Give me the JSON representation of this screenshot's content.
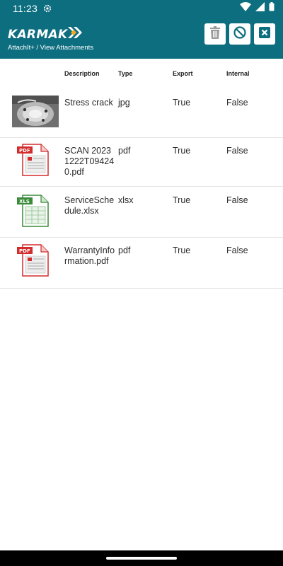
{
  "status_bar": {
    "time": "11:23"
  },
  "header": {
    "brand": "KARMAK",
    "subtitle": "AttachIt+ / View Attachments"
  },
  "toolbar": {
    "delete_icon": "trash-icon",
    "cancel_icon": "block-icon",
    "close_icon": "close-box-icon"
  },
  "table": {
    "headers": {
      "description": "Description",
      "type": "Type",
      "export": "Export",
      "internal": "Internal"
    },
    "rows": [
      {
        "thumbnail": "photo-thumbnail",
        "description": "Stress crack",
        "type": "jpg",
        "export": "True",
        "internal": "False"
      },
      {
        "thumbnail": "pdf-file-icon",
        "description": "SCAN 20231222T094240.pdf",
        "type": "pdf",
        "export": "True",
        "internal": "False"
      },
      {
        "thumbnail": "xls-file-icon",
        "description": "ServiceSchedule.xlsx",
        "type": "xlsx",
        "export": "True",
        "internal": "False"
      },
      {
        "thumbnail": "pdf-file-icon",
        "description": "WarrantyInformation.pdf",
        "type": "pdf",
        "export": "True",
        "internal": "False"
      }
    ]
  },
  "colors": {
    "header_bg": "#0d6e80",
    "accent": "#f5a623",
    "pdf_red": "#d22c2c",
    "xls_green": "#3a8a3a"
  }
}
